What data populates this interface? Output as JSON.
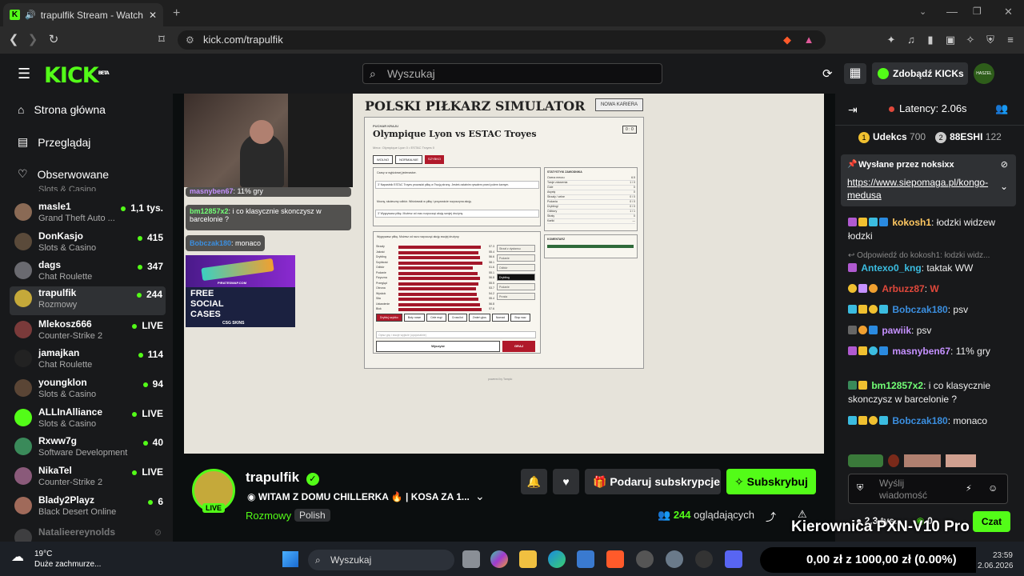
{
  "browser": {
    "tab_title": "trapulfik Stream - Watch Live",
    "url": "kick.com/trapulfik"
  },
  "header": {
    "logo": "KICK",
    "logo_beta": "BETA",
    "search_placeholder": "Wyszukaj",
    "kicks_button": "Zdobądź KICKs",
    "avatar_text": "HASZEL"
  },
  "sidebar": {
    "nav": [
      "Strona główna",
      "Przeglądaj",
      "Obserwowane"
    ],
    "partial_top": "Slots & Casino",
    "channels": [
      {
        "name": "masle1",
        "category": "Grand Theft Auto ...",
        "count": "1,1 tys."
      },
      {
        "name": "DonKasjo",
        "category": "Slots & Casino",
        "count": "415"
      },
      {
        "name": "dags",
        "category": "Chat Roulette",
        "count": "347"
      },
      {
        "name": "trapulfik",
        "category": "Rozmowy",
        "count": "244"
      },
      {
        "name": "Mlekosz666",
        "category": "Counter-Strike 2",
        "count": "LIVE"
      },
      {
        "name": "jamajkan",
        "category": "Chat Roulette",
        "count": "114"
      },
      {
        "name": "youngklon",
        "category": "Slots & Casino",
        "count": "94"
      },
      {
        "name": "ALLInAlliance",
        "category": "Slots & Casino",
        "count": "LIVE"
      },
      {
        "name": "Rxww7g",
        "category": "Software Development",
        "count": "40"
      },
      {
        "name": "NikaTel",
        "category": "Counter-Strike 2",
        "count": "LIVE"
      },
      {
        "name": "Blady2Playz",
        "category": "Black Desert Online",
        "count": "6"
      }
    ],
    "offline_channel": "Natalieereynolds"
  },
  "video": {
    "game_title": "POLSKI PIŁKARZ SIMULATOR",
    "new_career": "NOWA KARIERA",
    "cup_label": "PUCHAR KRAJU",
    "match": "Olympique Lyon vs ESTAC Troyes",
    "score": "0 : 0",
    "match_sub": "Mecz: Olympique Lyon 0 • ESTAC Troyes 0",
    "tempo_buttons": [
      "WOLNO",
      "NORMALNIE",
      "SZYBKO"
    ],
    "event1": "Czasy w wyjściowej jedenastce.",
    "event2": "3' Napastnik ESTAC Troyes prowadzi piłkę w Twoją stronę. Jesteś ostatnim rywalem przed polem karnym.",
    "event3": "Mocny, skuteczny odbiór. Wiśniowski w piłkę i przyzwoicie rozpoczyna akcję.",
    "event4": "3' Wygrywasz piłkę. Możesz od razu rozpocząć akcję swojej drużyny.",
    "stats_title": "STATYSTYKI ZAWODNIKA",
    "stats": [
      [
        "Ocena meczu",
        "6.5"
      ],
      [
        "Twoje zdarzenia",
        "1 / 0"
      ],
      [
        "Gole",
        "0"
      ],
      [
        "Asysty",
        "0"
      ],
      [
        "Strzały / celne",
        "0 / 0"
      ],
      [
        "Podania",
        "0 / 0"
      ],
      [
        "Dryblingi",
        "0 / 0"
      ],
      [
        "Odbiory",
        "1 / 1"
      ],
      [
        "Straty",
        "0"
      ],
      [
        "Kartki",
        "—"
      ]
    ],
    "action_prompt": "Wygrywasz piłkę. Możesz od razu rozpocząć akcję swojej drużyny.",
    "skills": [
      [
        "Strzały",
        "57.3"
      ],
      [
        "Jakość",
        "55.4"
      ],
      [
        "Drybling",
        "56.6"
      ],
      [
        "Szybkość",
        "58.1"
      ],
      [
        "Odbiór",
        "51.6"
      ],
      [
        "Podanie",
        "55.1"
      ],
      [
        "Fizyczna",
        "56.8"
      ],
      [
        "Przegląd",
        "55.5"
      ],
      [
        "Obrona",
        "53.7"
      ],
      [
        "Wyskok",
        "54.2"
      ],
      [
        "Siła",
        "55.4"
      ],
      [
        "Ustawienie",
        "56.8"
      ],
      [
        "Blok",
        "57.6"
      ]
    ],
    "choices": [
      "Strzał z dystansu",
      "Podanie",
      "Odbiór",
      "Drybling",
      "Podanie",
      "Prosta"
    ],
    "bottom_buttons": [
      "Drybluj szybko",
      "Boty nowe",
      "Cele mąż",
      "Cross/lot",
      "Zmień głos",
      "Nomad",
      "Stop wav"
    ],
    "input_placeholder": "Opisz grę i swoje wyjście (opcjonalnie)",
    "btn_clear": "Wyczyść",
    "btn_play": "GRAJ",
    "commentary_title": "KOMENTARZ",
    "footer": "powered by Tamplo",
    "overlay_msgs": [
      {
        "user": "masnyben67",
        "text": "11% gry"
      },
      {
        "user": "bm12857x2",
        "text": "i co klasycznie skonczysz w barcelonie ?"
      },
      {
        "user": "Bobczak180",
        "text": "monaco"
      }
    ],
    "ad_text1": "FREE",
    "ad_text2": "SOCIAL",
    "ad_text3": "CASES",
    "ad_brand": "CSG SKINS",
    "ad_url": "PIRATESWAP.COM"
  },
  "stream": {
    "streamer": "trapulfik",
    "live_badge": "LIVE",
    "title": "WITAM Z DOMU CHILLERKA 🔥 | KOSA ZA 1...",
    "category": "Rozmowy",
    "tag": "Polish",
    "viewers": "244",
    "viewers_label": "oglądających",
    "gift_sub": "Podaruj subskrypcje",
    "subscribe": "Subskrybuj",
    "bottom_stats": [
      "2,3 tys.",
      "0"
    ],
    "overlay_text": "Kierownica PXN-V10 Pro"
  },
  "chat": {
    "latency": "Latency: 2.06s",
    "leaderboard": [
      {
        "rank": "1",
        "name": "Udekcs",
        "value": "700"
      },
      {
        "rank": "2",
        "name": "88ESHI",
        "value": "122"
      }
    ],
    "pinned_by": "Wysłane przez noksixx",
    "pinned_link": "https://www.siepomaga.pl/kongo-medusa",
    "reply_to": "Odpowiedź do kokosh1: łodzki widz...",
    "messages": [
      {
        "user": "kokosh1",
        "text": "łodzki widzew łodzki",
        "color": "#ffc861"
      },
      {
        "user": "Antexo0_kng",
        "text": "taktak WW",
        "color": "#3bbce0"
      },
      {
        "user": "Arbuzz87",
        "text": "W",
        "color": "#e0483b"
      },
      {
        "user": "Bobczak180",
        "text": "psv",
        "color": "#3b8fe0"
      },
      {
        "user": "pawiik",
        "text": "psv",
        "color": "#c591ff"
      },
      {
        "user": "masnyben67",
        "text": "11% gry",
        "color": "#c591ff"
      },
      {
        "user": "bm12857x2",
        "text": "i co klasycznie skonczysz w barcelonie ?",
        "color": "#72ff76"
      },
      {
        "user": "Bobczak180",
        "text": "monaco",
        "color": "#3b8fe0"
      }
    ],
    "input_placeholder": "Wyślij wiadomość",
    "send_button": "Czat"
  },
  "taskbar": {
    "weather_temp": "19°C",
    "weather_desc": "Duże zachmurze...",
    "search_placeholder": "Wyszukaj",
    "donation": "0,00 zł z 1000,00 zł (0.00%)",
    "time": "23:59",
    "date": "2.06.2026"
  }
}
